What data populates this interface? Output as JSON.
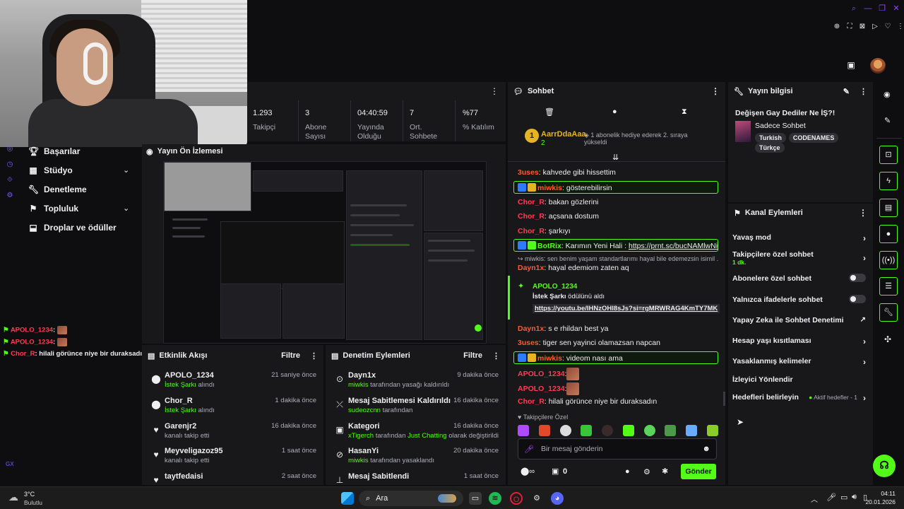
{
  "stats": [
    {
      "value": "1.293",
      "label": "Takipçi"
    },
    {
      "value": "3",
      "label": "Abone Sayısı"
    },
    {
      "value": "04:40:59",
      "label": "Yayında Olduğu"
    },
    {
      "value": "7",
      "label": "Ort. Sohbete"
    },
    {
      "value": "%77",
      "label": "% Katılım"
    }
  ],
  "nav": {
    "items": [
      {
        "label": "Başarılar",
        "icon": "trophy-icon"
      },
      {
        "label": "Stüdyo",
        "icon": "studio-icon"
      },
      {
        "label": "Denetleme",
        "icon": "wrench-icon"
      },
      {
        "label": "Topluluk",
        "icon": "community-icon"
      },
      {
        "label": "Droplar ve ödüller",
        "icon": "drops-icon"
      }
    ]
  },
  "left_chat": [
    {
      "user": "APOLO_1234",
      "text": ":"
    },
    {
      "user": "APOLO_1234",
      "text": ":"
    },
    {
      "user": "Chor_R",
      "text": ": hilali görünce niye bir duraksadın"
    }
  ],
  "preview": {
    "title": "Yayın Ön İzlemesi"
  },
  "activity": {
    "title": "Etkinlik Akışı",
    "filter": "Filtre",
    "items": [
      {
        "name": "APOLO_1234",
        "sub_hl": "İstek Şarkı",
        "sub": " alındı",
        "time": "21 saniye önce",
        "icon": "points-icon"
      },
      {
        "name": "Chor_R",
        "sub_hl": "İstek Şarkı",
        "sub": " alındı",
        "time": "1 dakika önce",
        "icon": "points-icon"
      },
      {
        "name": "Garenjr2",
        "sub_hl": "",
        "sub": "kanalı takip etti",
        "time": "16 dakika önce",
        "icon": "heart-icon"
      },
      {
        "name": "Meyveligazoz95",
        "sub_hl": "",
        "sub": "kanalı takip etti",
        "time": "1 saat önce",
        "icon": "heart-icon"
      },
      {
        "name": "taytfedaisi",
        "sub_hl": "",
        "sub": "",
        "time": "2 saat önce",
        "icon": "heart-icon"
      }
    ]
  },
  "modlog": {
    "title": "Denetim Eylemleri",
    "filter": "Filtre",
    "items": [
      {
        "name": "Dayn1x",
        "who": "miwkis",
        "sub": " tarafından yasağı kaldırıldı",
        "extra": "",
        "extra2": "",
        "time": "9 dakika önce",
        "icon": "unban-icon"
      },
      {
        "name": "Mesaj Sabitlemesi Kaldırıldı",
        "who": "sudeozcnn",
        "sub": " tarafından",
        "extra": "",
        "extra2": "",
        "time": "16 dakika önce",
        "icon": "unpin-icon"
      },
      {
        "name": "Kategori",
        "who": "xTigerch",
        "sub": " tarafından ",
        "extra": "Just Chatting",
        "extra2": " olarak değiştirildi",
        "time": "16 dakika önce",
        "icon": "category-icon"
      },
      {
        "name": "HasanYi",
        "who": "miwkis",
        "sub": " tarafından yasaklandı",
        "extra": "",
        "extra2": "",
        "time": "20 dakika önce",
        "icon": "ban-icon"
      },
      {
        "name": "Mesaj Sabitlendi",
        "who": "",
        "sub": "",
        "extra": "",
        "extra2": "",
        "time": "1 saat önce",
        "icon": "pin-icon"
      }
    ]
  },
  "chat": {
    "title": "Sohbet",
    "gifter": {
      "name": "AarrDdaAaa",
      "count": "2",
      "text": "1 abonelik hediye ederek 2. sıraya yükseldi"
    },
    "messages": [
      {
        "user": "3uses",
        "text": ": kahvede gibi hissettim",
        "color": "orange",
        "hl": false
      },
      {
        "user": "miwkis",
        "text": ": gösterebilirsin",
        "color": "orange",
        "hl": true
      },
      {
        "user": "Chor_R",
        "text": ": bakan gözlerini",
        "color": "red",
        "hl": false
      },
      {
        "user": "Chor_R",
        "text": ": açsana dostum",
        "color": "red",
        "hl": false
      },
      {
        "user": "Chor_R",
        "text": ": şarkıyı",
        "color": "red",
        "hl": false
      },
      {
        "user": "BotRix",
        "text": ": Karımın Yeni Hali : ",
        "link": "https://prnt.sc/bucNAMlwNi0E",
        "color": "green",
        "hl": true
      }
    ],
    "reply": "miwkis: sen benim yaşam standartlarımı hayal bile edemezsin isimil ...",
    "reply_msg": {
      "user": "Dayn1x",
      "text": ": hayal edemiom zaten aq"
    },
    "redeem": {
      "user": "APOLO_1234",
      "reward": "İstek Şarkı",
      "text": " ödülünü aldı",
      "link": "https://youtu.be/IHNzOHl8sJs?si=rgMRWRAG4KmTY7MK"
    },
    "messages2": [
      {
        "user": "Dayn1x",
        "text": ": s e rhildan best ya",
        "color": "orange",
        "hl": false
      },
      {
        "user": "3uses",
        "text": ": tiger sen yayinci olamazsan napcan",
        "color": "orange",
        "hl": false
      },
      {
        "user": "miwkis",
        "text": ": videom nası ama",
        "color": "orange",
        "hl": true
      },
      {
        "user": "APOLO_1234",
        "text": ":",
        "color": "red",
        "hl": false
      },
      {
        "user": "APOLO_1234",
        "text": ":",
        "color": "red",
        "hl": false
      },
      {
        "user": "Chor_R",
        "text": ": hilali görünce niye bir duraksadın",
        "color": "red",
        "hl": false
      }
    ],
    "followers_only": "Takipçilere Özel",
    "input_placeholder": "Bir mesaj gönderin",
    "points": "0",
    "send": "Gönder"
  },
  "info": {
    "title": "Yayın bilgisi",
    "stream_title": "Değişen Gay Dediler Ne İŞ?!",
    "category": "Sadece Sohbet",
    "tags": [
      "Turkish",
      "CODENAMES",
      "Türkçe"
    ]
  },
  "actions": {
    "title": "Kanal Eylemleri",
    "items": [
      {
        "label": "Yavaş mod",
        "type": "arrow",
        "sub": ""
      },
      {
        "label": "Takipçilere özel sohbet",
        "type": "arrow",
        "sub": "1 dk."
      },
      {
        "label": "Abonelere özel sohbet",
        "type": "toggle",
        "sub": ""
      },
      {
        "label": "Yalnızca ifadelerle sohbet",
        "type": "toggle",
        "sub": ""
      },
      {
        "label": "Yapay Zeka ile Sohbet Denetimi",
        "type": "external",
        "sub": ""
      },
      {
        "label": "Hesap yaşı kısıtlaması",
        "type": "arrow",
        "sub": ""
      },
      {
        "label": "Yasaklanmış kelimeler",
        "type": "arrow",
        "sub": ""
      },
      {
        "label": "İzleyici Yönlendir",
        "type": "none",
        "sub": ""
      },
      {
        "label": "Hedefleri belirleyin",
        "type": "arrow",
        "sub": "",
        "status": "Aktif hedefler - 1"
      }
    ]
  },
  "taskbar": {
    "weather_temp": "3°C",
    "weather_desc": "Bulutlu",
    "search": "Ara",
    "time": "04:11",
    "date": "20.01.2026",
    "gx": "GX"
  },
  "colors": {
    "accent": "#53fc18",
    "panel": "#18181b",
    "bg": "#0e0e10",
    "purple": "#9147ff"
  }
}
